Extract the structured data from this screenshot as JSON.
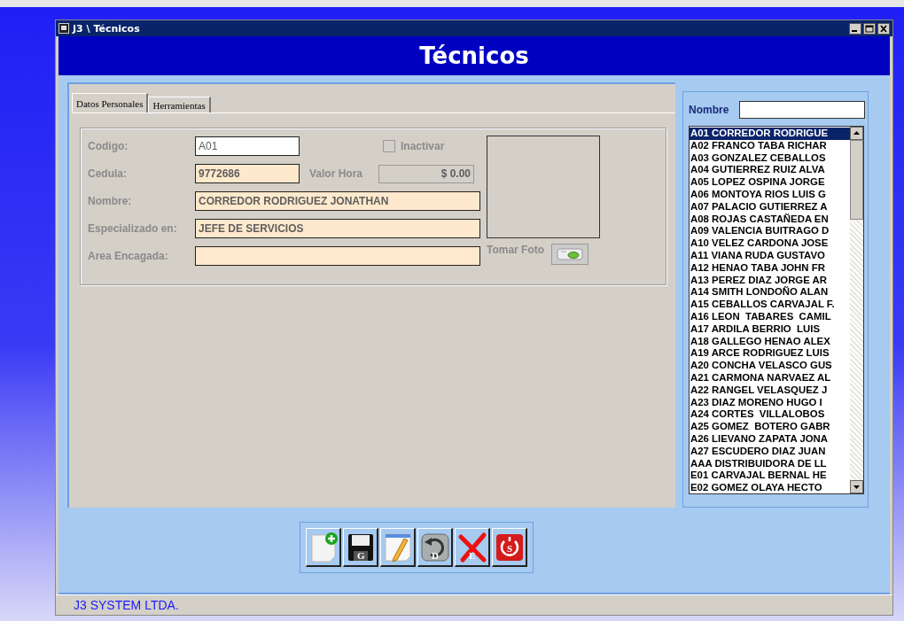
{
  "window": {
    "title": "J3 \\ Técnicos"
  },
  "header": {
    "title": "Técnicos"
  },
  "tabs": [
    {
      "label": "Datos Personales",
      "selected": true
    },
    {
      "label": "Herramientas",
      "selected": false
    }
  ],
  "form": {
    "codigo": {
      "label": "Codigo:",
      "value": "A01"
    },
    "inactivar": {
      "label": "Inactivar",
      "checked": false,
      "disabled": true
    },
    "cedula": {
      "label": "Cedula:",
      "value": "9772686"
    },
    "valor_hora": {
      "label": "Valor Hora",
      "value": "$ 0.00"
    },
    "nombre": {
      "label": "Nombre:",
      "value": "CORREDOR RODRIGUEZ JONATHAN"
    },
    "especializado": {
      "label": "Especializado en:",
      "value": "JEFE DE SERVICIOS"
    },
    "area": {
      "label": "Area Encagada:"
    },
    "tomar_foto": {
      "label": "Tomar Foto"
    }
  },
  "search": {
    "label": "Nombre"
  },
  "list": {
    "items": [
      {
        "text": "A01 CORREDOR RODRIGUE",
        "selected": true
      },
      {
        "text": "A02 FRANCO TABA RICHAR",
        "selected": false
      },
      {
        "text": "A03 GONZALEZ CEBALLOS",
        "selected": false
      },
      {
        "text": "A04 GUTIERREZ RUIZ ALVA",
        "selected": false
      },
      {
        "text": "A05 LOPEZ OSPINA JORGE",
        "selected": false
      },
      {
        "text": "A06 MONTOYA RIOS LUIS G",
        "selected": false
      },
      {
        "text": "A07 PALACIO GUTIERREZ A",
        "selected": false
      },
      {
        "text": "A08 ROJAS CASTAÑEDA EN",
        "selected": false
      },
      {
        "text": "A09 VALENCIA BUITRAGO D",
        "selected": false
      },
      {
        "text": "A10 VELEZ CARDONA JOSE",
        "selected": false
      },
      {
        "text": "A11 VIANA RUDA GUSTAVO",
        "selected": false
      },
      {
        "text": "A12 HENAO TABA JOHN FR",
        "selected": false
      },
      {
        "text": "A13 PEREZ DIAZ JORGE AR",
        "selected": false
      },
      {
        "text": "A14 SMITH LONDOÑO ALAN",
        "selected": false
      },
      {
        "text": "A15 CEBALLOS CARVAJAL F.",
        "selected": false
      },
      {
        "text": "A16 LEON  TABARES  CAMIL",
        "selected": false
      },
      {
        "text": "A17 ARDILA BERRIO  LUIS",
        "selected": false
      },
      {
        "text": "A18 GALLEGO HENAO ALEX",
        "selected": false
      },
      {
        "text": "A19 ARCE RODRIGUEZ LUIS",
        "selected": false
      },
      {
        "text": "A20 CONCHA VELASCO GUS",
        "selected": false
      },
      {
        "text": "A21 CARMONA NARVAEZ AL",
        "selected": false
      },
      {
        "text": "A22 RANGEL VELASQUEZ J",
        "selected": false
      },
      {
        "text": "A23 DIAZ MORENO HUGO I",
        "selected": false
      },
      {
        "text": "A24 CORTES  VILLALOBOS",
        "selected": false
      },
      {
        "text": "A25 GOMEZ  BOTERO GABR",
        "selected": false
      },
      {
        "text": "A26 LIEVANO ZAPATA JONA",
        "selected": false
      },
      {
        "text": "A27 ESCUDERO DIAZ JUAN",
        "selected": false
      },
      {
        "text": "AAA DISTRIBUIDORA DE LL",
        "selected": false
      },
      {
        "text": "E01 CARVAJAL BERNAL HE",
        "selected": false
      },
      {
        "text": "E02 GOMEZ OLAYA HECTO",
        "selected": false
      }
    ]
  },
  "toolbar": [
    {
      "kind": "new"
    },
    {
      "kind": "save",
      "letter": "G"
    },
    {
      "kind": "edit"
    },
    {
      "kind": "undo",
      "letter": "D"
    },
    {
      "kind": "delete",
      "letter": "E"
    },
    {
      "kind": "exit",
      "letter": "S"
    }
  ],
  "status_bar": {
    "text": "J3 SYSTEM LTDA."
  }
}
